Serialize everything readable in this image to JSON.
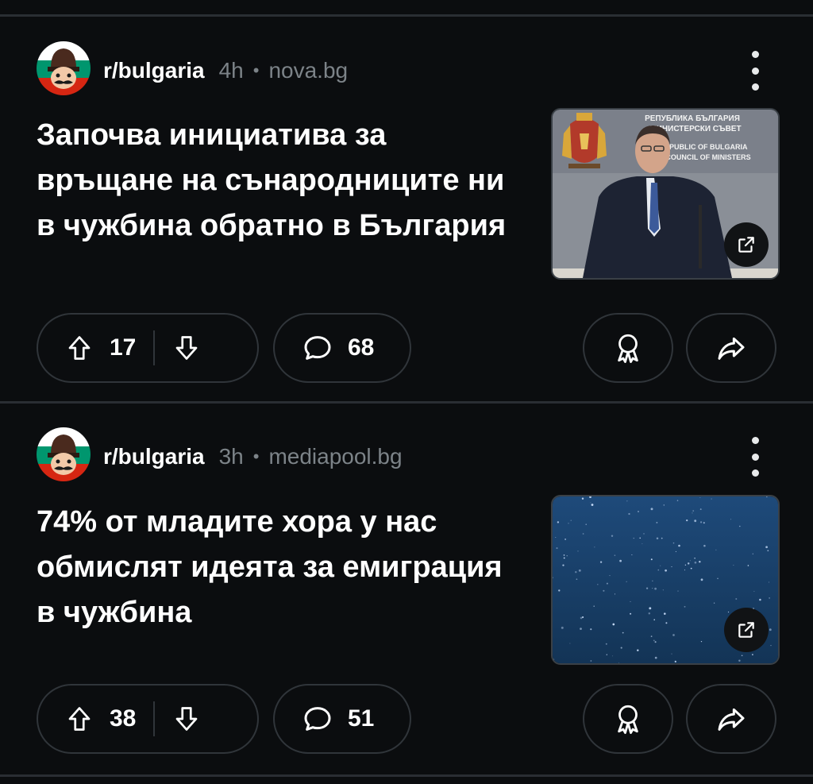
{
  "posts": [
    {
      "subreddit": "r/bulgaria",
      "age": "4h",
      "separator": "•",
      "domain": "nova.bg",
      "title": "Започва инициатива за връщане на сънародниците ни в чужбина обратно в България",
      "thumbnail": {
        "kind": "press-conference",
        "banner_lines": [
          "РЕПУБЛИКА БЪЛГАРИЯ",
          "МИНИСТЕРСКИ СЪВЕТ",
          "REPUBLIC OF BULGARIA",
          "COUNCIL OF MINISTERS"
        ]
      },
      "upvotes": "17",
      "comments": "68"
    },
    {
      "subreddit": "r/bulgaria",
      "age": "3h",
      "separator": "•",
      "domain": "mediapool.bg",
      "title": "74% от младите хора у нас обмислят идеята за емиграция в чужбина",
      "thumbnail": {
        "kind": "starry-sky"
      },
      "upvotes": "38",
      "comments": "51"
    }
  ],
  "icons": {
    "more": "more-vertical-icon",
    "upvote": "arrow-up-icon",
    "downvote": "arrow-down-icon",
    "comment": "speech-bubble-icon",
    "award": "award-ribbon-icon",
    "share": "share-arrow-icon",
    "external": "external-link-icon"
  },
  "colors": {
    "background": "#0b0d0f",
    "divider": "#2a2e33",
    "text": "#ffffff",
    "muted": "#7c8388",
    "flag_white": "#ffffff",
    "flag_green": "#00966e",
    "flag_red": "#d62612"
  }
}
